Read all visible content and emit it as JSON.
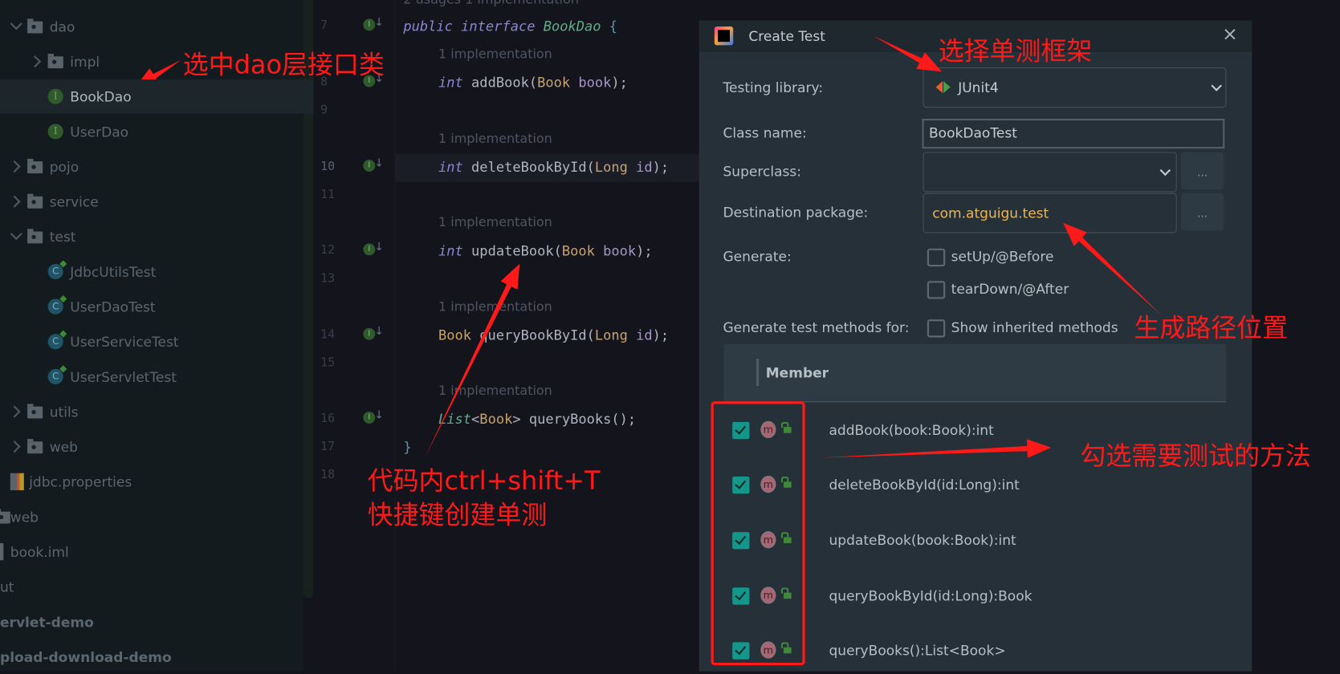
{
  "project_tree": [
    {
      "label": "dao",
      "type": "folder",
      "expanded": true,
      "level": 0
    },
    {
      "label": "impl",
      "type": "folder",
      "expanded": false,
      "level": 1
    },
    {
      "label": "BookDao",
      "type": "interface",
      "level": 1,
      "selected": true
    },
    {
      "label": "UserDao",
      "type": "interface",
      "level": 1
    },
    {
      "label": "pojo",
      "type": "folder",
      "expanded": false,
      "level": 0
    },
    {
      "label": "service",
      "type": "folder",
      "expanded": false,
      "level": 0
    },
    {
      "label": "test",
      "type": "folder",
      "expanded": true,
      "level": 0
    },
    {
      "label": "JdbcUtilsTest",
      "type": "test-class",
      "level": 1
    },
    {
      "label": "UserDaoTest",
      "type": "test-class",
      "level": 1
    },
    {
      "label": "UserServiceTest",
      "type": "test-class",
      "level": 1
    },
    {
      "label": "UserServletTest",
      "type": "test-class",
      "level": 1
    },
    {
      "label": "utils",
      "type": "folder",
      "expanded": false,
      "level": 0
    },
    {
      "label": "web",
      "type": "folder",
      "expanded": false,
      "level": 0
    },
    {
      "label": "jdbc.properties",
      "type": "properties",
      "level": 0
    },
    {
      "label": "web",
      "type": "folder",
      "level": -1
    },
    {
      "label": "book.iml",
      "type": "file",
      "level": -1
    },
    {
      "label": "ut",
      "type": "folder",
      "level": -2
    },
    {
      "label": "ervlet-demo",
      "type": "module",
      "level": -2
    },
    {
      "label": "pload-download-demo",
      "type": "module",
      "level": -2
    }
  ],
  "editor": {
    "top_hint": "2 usages   1 implementation",
    "hint": "1 implementation",
    "line_numbers": [
      "7",
      "8",
      "9",
      "10",
      "11",
      "12",
      "13",
      "14",
      "15",
      "16",
      "17",
      "18"
    ],
    "current_line": "10",
    "lines": {
      "l7": {
        "kw": "public interface ",
        "name": "BookDao",
        "rest": " {"
      },
      "l8": {
        "kw": "int",
        "name": " addBook(",
        "type": "Book",
        "param": " book",
        "end": ");"
      },
      "l10": {
        "kw": "int",
        "name": " deleteBookById(",
        "type": "Long",
        "param": " id",
        "end": ");"
      },
      "l12": {
        "kw": "int",
        "name": " updateBook(",
        "type": "Book",
        "param": " book",
        "end": ");"
      },
      "l14": {
        "type": "Book",
        "name": " queryBookById(",
        "type2": "Long",
        "param": " id",
        "end": ");"
      },
      "l16": {
        "iface": "List",
        "lt": "<",
        "type": "Book",
        "gt": ">",
        "name": " queryBooks();"
      },
      "l17": "}"
    }
  },
  "dialog": {
    "title": "Create Test",
    "testing_library_label": "Testing library:",
    "testing_library_value": "JUnit4",
    "class_name_label": "Class name:",
    "class_name_value": "BookDaoTest",
    "superclass_label": "Superclass:",
    "superclass_value": "",
    "destination_label": "Destination package:",
    "destination_value": "com.atguigu.test",
    "browse_label": "...",
    "generate_label": "Generate:",
    "generate_options": [
      {
        "label": "setUp/@Before",
        "checked": false
      },
      {
        "label": "tearDown/@After",
        "checked": false
      }
    ],
    "methods_for_label": "Generate test methods for:",
    "show_inherited": {
      "label": "Show inherited methods",
      "checked": false
    },
    "member_header": "Member",
    "members": [
      {
        "label": "addBook(book:Book):int",
        "checked": true,
        "icon": "m"
      },
      {
        "label": "deleteBookById(id:Long):int",
        "checked": true,
        "icon": "m"
      },
      {
        "label": "updateBook(book:Book):int",
        "checked": true,
        "icon": "m"
      },
      {
        "label": "queryBookById(id:Long):Book",
        "checked": true,
        "icon": "m"
      },
      {
        "label": "queryBooks():List<Book>",
        "checked": true,
        "icon": "m"
      }
    ]
  },
  "annotations": {
    "select_dao": "选中dao层接口类",
    "select_framework": "选择单测框架",
    "path_location": "生成路径位置",
    "check_methods": "勾选需要测试的方法",
    "shortcut_line1": "代码内ctrl+shift+T",
    "shortcut_line2": "快捷键创建单测",
    "color": "#ff1a1a"
  },
  "colors": {
    "accent_checkbox": "#14978a",
    "package_text": "#e8b55a",
    "dialog_bg": "#263038",
    "editor_bg": "#13141c"
  }
}
